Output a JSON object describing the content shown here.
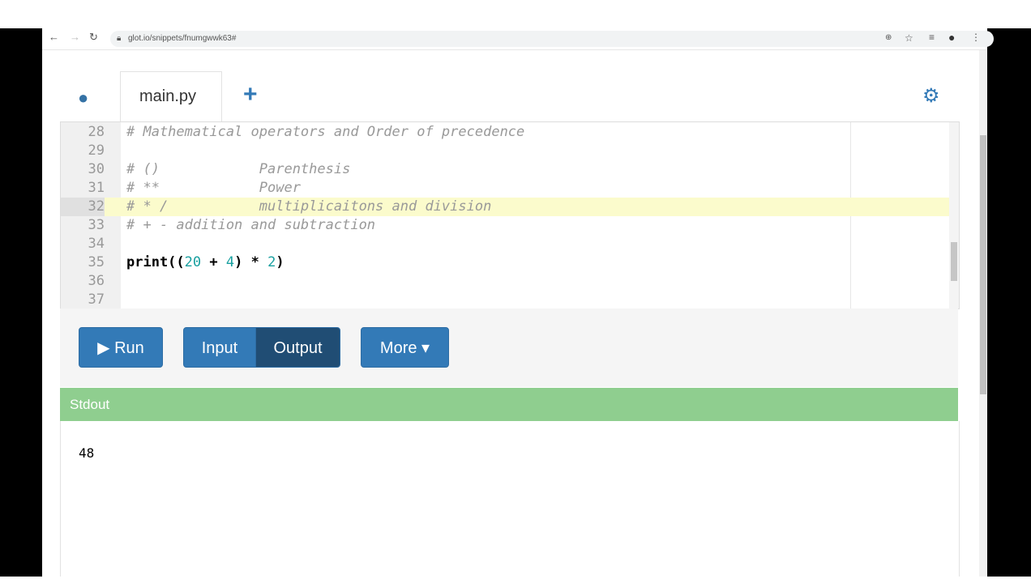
{
  "browser": {
    "url": "glot.io/snippets/fnumgwwk63#"
  },
  "tabs": {
    "file": "main.py",
    "add": "+"
  },
  "editor": {
    "lines": [
      {
        "n": "28",
        "text": "# Mathematical operators and Order of precedence"
      },
      {
        "n": "29",
        "text": ""
      },
      {
        "n": "30",
        "text": "# ()            Parenthesis"
      },
      {
        "n": "31",
        "text": "# **            Power"
      },
      {
        "n": "32",
        "text": "# * /           multiplicaitons and division"
      },
      {
        "n": "33",
        "text": "# + - addition and subtraction"
      },
      {
        "n": "34",
        "text": ""
      },
      {
        "n": "35",
        "a": "print((",
        "b": "20",
        "c": " + ",
        "d": "4",
        "e": ") * ",
        "f": "2",
        "g": ")"
      },
      {
        "n": "36",
        "text": ""
      },
      {
        "n": "37",
        "text": ""
      }
    ]
  },
  "buttons": {
    "run": "▶ Run",
    "input": "Input",
    "output": "Output",
    "more": "More ▾"
  },
  "stdout": {
    "title": "Stdout",
    "value": "48"
  }
}
